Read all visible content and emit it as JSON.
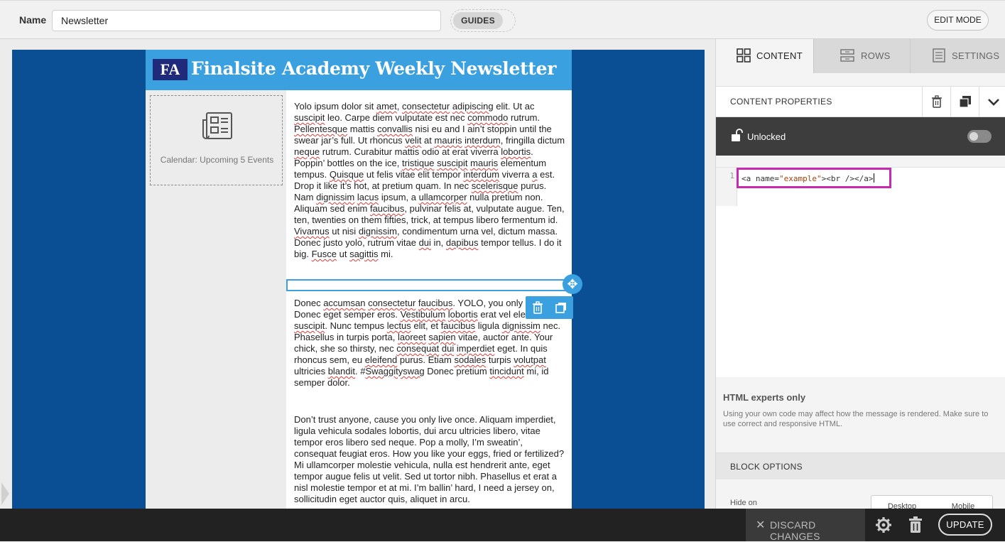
{
  "topbar": {
    "name_label": "Name",
    "name_value": "Newsletter",
    "guides_label": "GUIDES",
    "edit_mode_label": "EDIT MODE"
  },
  "newsletter": {
    "logo_text": "FA",
    "title": "Finalsite Academy Weekly Newsletter",
    "calendar_label": "Calendar: Upcoming 5 Events",
    "colors": {
      "background": "#0a4f94",
      "header": "#3aa0df",
      "logo": "#1f2a7a"
    }
  },
  "panel": {
    "tabs": [
      {
        "label": "CONTENT",
        "icon": "grid-icon"
      },
      {
        "label": "ROWS",
        "icon": "rows-icon"
      },
      {
        "label": "SETTINGS",
        "icon": "settings-list-icon"
      }
    ],
    "properties_title": "CONTENT PROPERTIES",
    "lock_label": "Unlocked",
    "code_line_number": "1",
    "code_segments": [
      "<a name=",
      "\"example\"",
      "><br /></a>"
    ],
    "experts_title": "HTML experts only",
    "experts_text": "Using your own code may affect how the message is rendered. Make sure to use correct and responsive HTML.",
    "block_options_title": "BLOCK OPTIONS",
    "hide_on_label": "Hide on",
    "hide_on_options": [
      "Desktop",
      "Mobile"
    ],
    "highlight_color": "#c42bb0"
  },
  "bottombar": {
    "discard_label": "DISCARD CHANGES",
    "update_label": "UPDATE"
  }
}
